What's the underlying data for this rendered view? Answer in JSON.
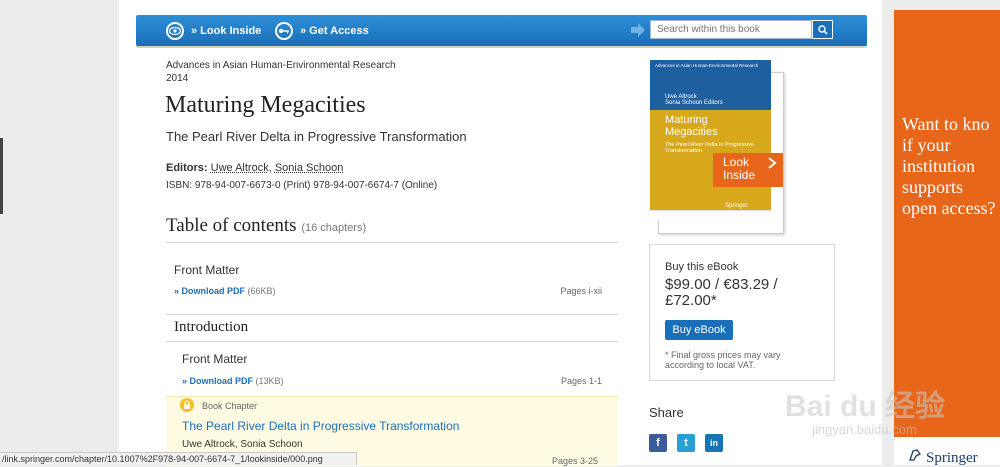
{
  "toolbar": {
    "look_inside": "» Look Inside",
    "get_access": "» Get Access",
    "search_placeholder": "Search within this book"
  },
  "book": {
    "series": "Advances in Asian Human-Environmental Research",
    "year": "2014",
    "title": "Maturing Megacities",
    "subtitle": "The Pearl River Delta in Progressive Transformation",
    "editors_label": "Editors:",
    "editor1": "Uwe Altrock",
    "editor2": "Sonia Schoon",
    "isbn": "ISBN: 978-94-007-6673-0 (Print) 978-94-007-6674-7 (Online)"
  },
  "toc": {
    "heading": "Table of contents",
    "count": "(16 chapters)",
    "front_matter": {
      "title": "Front Matter",
      "download": "» Download PDF",
      "size": "(66KB)",
      "pages": "Pages i-xii"
    },
    "section": "Introduction",
    "intro_front_matter": {
      "title": "Front Matter",
      "download": "» Download PDF",
      "size": "(13KB)",
      "pages": "Pages 1-1"
    },
    "chapter": {
      "label": "Book Chapter",
      "title": "The Pearl River Delta in Progressive Transformation",
      "authors": "Uwe Altrock, Sonia Schoon",
      "pages": "Pages 3-25"
    }
  },
  "cover": {
    "series": "Advances in Asian Human-Environmental Research",
    "editors_line1": "Uwe Altrock",
    "editors_line2": "Sonia Schoon   Editors",
    "title1": "Maturing",
    "title2": "Megacities",
    "sub1": "The Pearl River Delta in Progressive",
    "sub2": "Transformation",
    "publisher": "Springer",
    "badge_line1": "Look",
    "badge_line2": "Inside"
  },
  "buy": {
    "label": "Buy this eBook",
    "price_line1": "$99.00 / €83.29 /",
    "price_line2": "£72.00*",
    "button": "Buy eBook",
    "note_line1": "* Final gross prices may vary",
    "note_line2": "according to local VAT."
  },
  "share": {
    "label": "Share",
    "facebook": "f",
    "twitter": "t",
    "linkedin": "in"
  },
  "ad": {
    "line1": "Want to kno",
    "line2": "if your",
    "line3": "institution",
    "line4": "supports",
    "line5": "open access?",
    "brand": "Springer"
  },
  "status_url": "/link.springer.com/chapter/10.1007%2F978-94-007-6674-7_1/lookinside/000.png",
  "watermark": {
    "main": "Bai du 经验",
    "sub": "jingyan.baidu.com"
  },
  "colors": {
    "toolbar_blue": "#1a6fb8",
    "link_blue": "#1b6fb8",
    "accent_orange": "#e8661a",
    "cover_gold": "#d7a71c"
  }
}
